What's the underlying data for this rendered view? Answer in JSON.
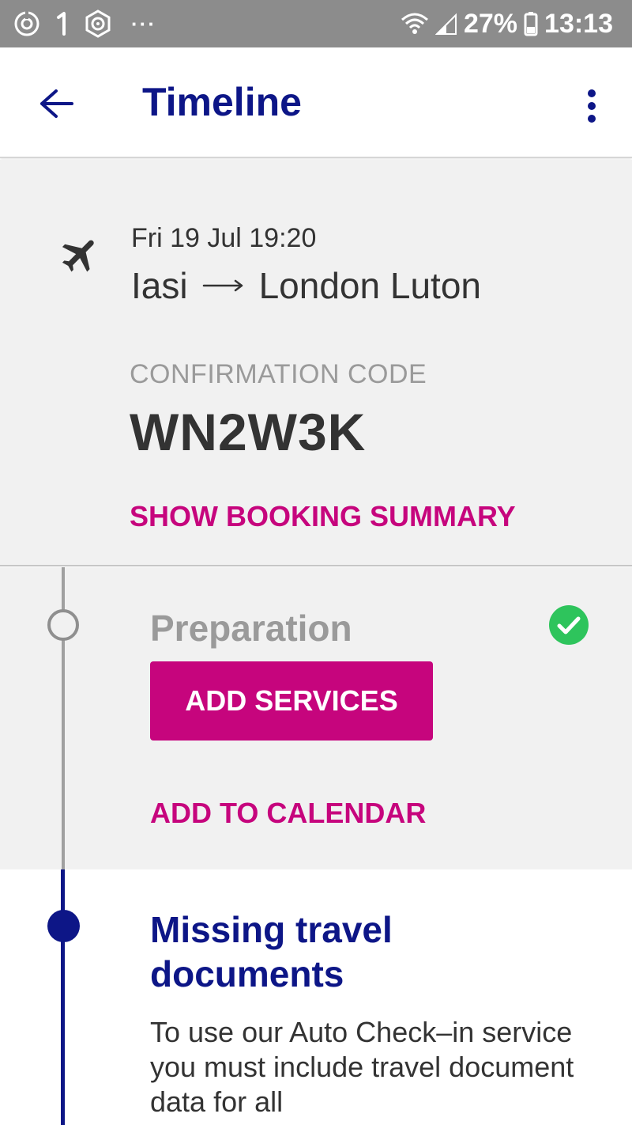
{
  "status_bar": {
    "battery": "27%",
    "time": "13:13",
    "icons": [
      "sync-icon",
      "notification-1-icon",
      "crypto-app-icon",
      "more-notifications-icon",
      "wifi-icon",
      "signal-icon",
      "battery-icon"
    ]
  },
  "app_bar": {
    "title": "Timeline",
    "back_icon": "arrow-left-icon",
    "menu_icon": "more-vert-icon"
  },
  "booking": {
    "date": "Fri 19 Jul 19:20",
    "origin": "Iasi",
    "destination": "London Luton",
    "confirmation_label": "CONFIRMATION CODE",
    "confirmation_code": "WN2W3K",
    "show_summary_label": "SHOW BOOKING SUMMARY"
  },
  "timeline": {
    "preparation": {
      "title": "Preparation",
      "add_services_label": "ADD SERVICES",
      "add_calendar_label": "ADD TO CALENDAR",
      "status": "completed"
    },
    "missing_docs": {
      "title": "Missing travel documents",
      "body": "To use our Auto Check–in service you must include travel document data for all"
    }
  },
  "colors": {
    "brand_blue": "#0d1687",
    "accent_magenta": "#c6057d",
    "success_green": "#2ec45c",
    "status_bar": "#8c8c8c",
    "surface_gray": "#f1f1f1"
  }
}
